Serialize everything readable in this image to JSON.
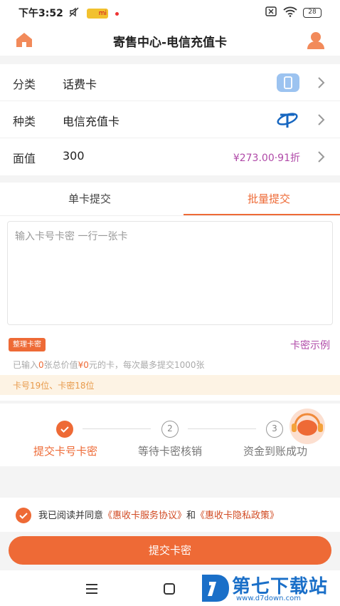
{
  "status_bar": {
    "time": "下午3:52",
    "mi_badge": "mi",
    "battery": "28"
  },
  "header": {
    "title": "寄售中心-电信充值卡",
    "home_icon": "home-icon",
    "user_icon": "user-icon"
  },
  "info": {
    "category_label": "分类",
    "category_value": "话费卡",
    "type_label": "种类",
    "type_value": "电信充值卡",
    "denomination_label": "面值",
    "denomination_value": "300",
    "price_text": "¥273.00·91折"
  },
  "tabs": {
    "single": "单卡提交",
    "batch": "批量提交",
    "active": "batch"
  },
  "form": {
    "placeholder": "输入卡号卡密 一行一张卡",
    "organize_button": "整理卡密",
    "example_link": "卡密示例",
    "count_prefix": "已输入",
    "count_cards": "0",
    "count_mid": "张总价值",
    "count_value": "¥0",
    "count_suffix": "元的卡，每次最多提交1000张",
    "hint": "卡号19位、卡密18位"
  },
  "steps": [
    {
      "label": "提交卡号卡密",
      "number": "1",
      "status": "done"
    },
    {
      "label": "等待卡密核销",
      "number": "2",
      "status": "todo"
    },
    {
      "label": "资金到账成功",
      "number": "3",
      "status": "todo"
    }
  ],
  "agreement": {
    "prefix": "我已阅读并同意",
    "service_link": "《惠收卡服务协议》",
    "and": "和",
    "privacy_link": "《惠收卡隐私政策》",
    "checked": true
  },
  "submit_label": "提交卡密",
  "watermark": {
    "name": "第七下载站",
    "url": "www.d7down.com"
  },
  "colors": {
    "accent": "#ee6a36",
    "price": "#b04aa8",
    "hint_bg": "#fdf3e4",
    "watermark": "#1a6fc8"
  }
}
